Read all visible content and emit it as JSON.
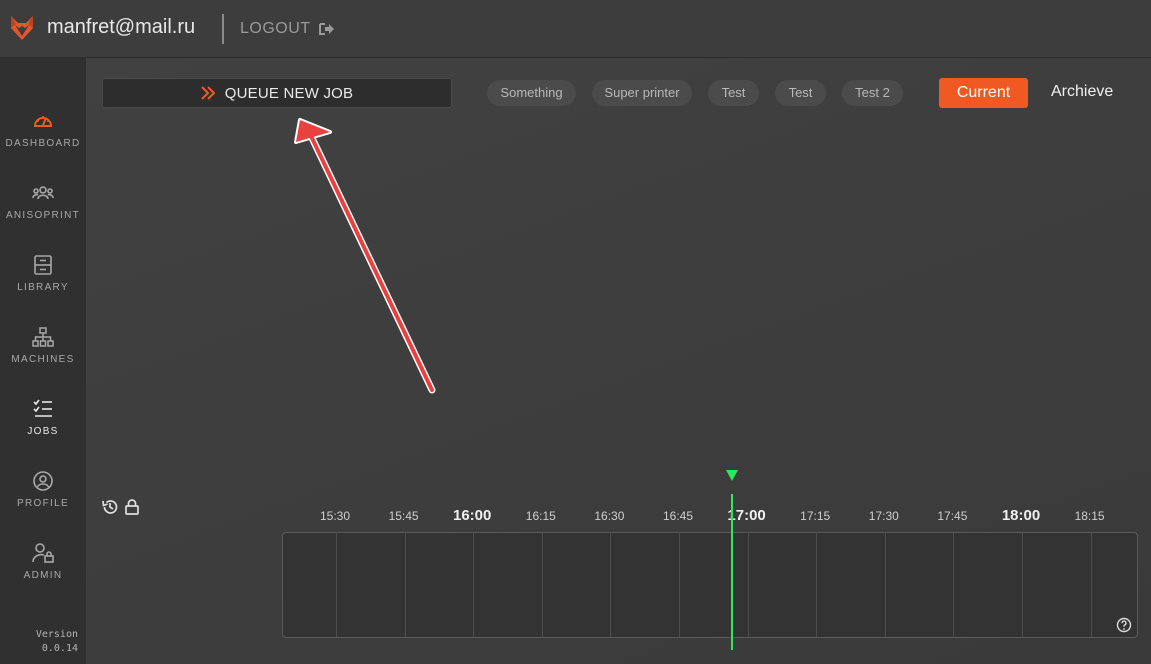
{
  "header": {
    "user_email": "manfret@mail.ru",
    "logout_label": "LOGOUT"
  },
  "sidebar": {
    "items": [
      {
        "label": "DASHBOARD",
        "icon": "dashboard-gauge-icon",
        "active": false
      },
      {
        "label": "ANISOPRINT",
        "icon": "users-group-icon",
        "active": false
      },
      {
        "label": "LIBRARY",
        "icon": "library-drawer-icon",
        "active": false
      },
      {
        "label": "MACHINES",
        "icon": "network-tree-icon",
        "active": false
      },
      {
        "label": "JOBS",
        "icon": "checklist-icon",
        "active": true
      },
      {
        "label": "PROFILE",
        "icon": "user-circle-icon",
        "active": false
      },
      {
        "label": "ADMIN",
        "icon": "user-lock-icon",
        "active": false
      }
    ],
    "version_label": "Version",
    "version_number": "0.0.14"
  },
  "toolbar": {
    "queue_label": "QUEUE NEW JOB",
    "machine_chips": [
      "Something",
      "Super printer",
      "Test",
      "Test",
      "Test 2"
    ],
    "current_label": "Current",
    "archieve_label": "Archieve"
  },
  "timeline": {
    "ticks": [
      "15:30",
      "15:45",
      "16:00",
      "16:15",
      "16:30",
      "16:45",
      "17:00",
      "17:15",
      "17:30",
      "17:45",
      "18:00",
      "18:15"
    ],
    "major_ticks": [
      "16:00",
      "17:00",
      "18:00"
    ]
  },
  "colors": {
    "accent": "#f05a22",
    "now_indicator": "#2ee65a",
    "annotation_arrow": "#e8413f"
  }
}
